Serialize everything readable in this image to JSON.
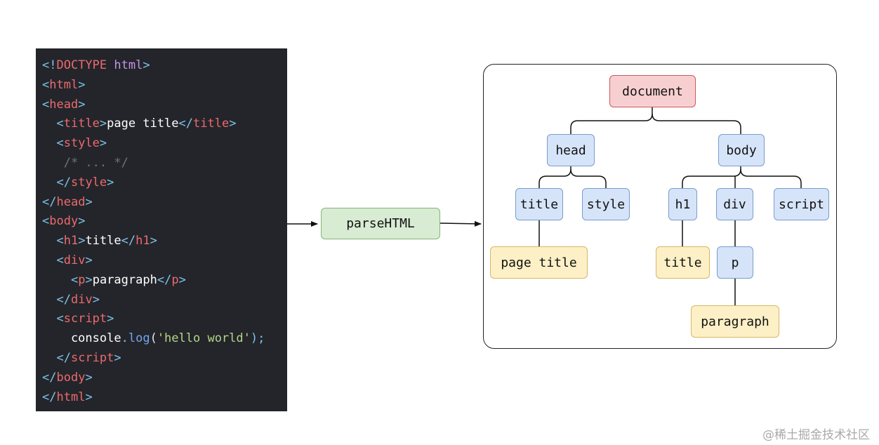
{
  "code": {
    "lines": [
      [
        {
          "t": "<!",
          "c": "punct"
        },
        {
          "t": "DOCTYPE",
          "c": "tag"
        },
        {
          "t": " html",
          "c": "attr"
        },
        {
          "t": ">",
          "c": "punct"
        }
      ],
      [
        {
          "t": "<",
          "c": "punct"
        },
        {
          "t": "html",
          "c": "tag"
        },
        {
          "t": ">",
          "c": "punct"
        }
      ],
      [
        {
          "t": "<",
          "c": "punct"
        },
        {
          "t": "head",
          "c": "tag"
        },
        {
          "t": ">",
          "c": "punct"
        }
      ],
      [
        {
          "t": "  ",
          "c": "plain"
        },
        {
          "t": "<",
          "c": "punct"
        },
        {
          "t": "title",
          "c": "tag"
        },
        {
          "t": ">",
          "c": "punct"
        },
        {
          "t": "page title",
          "c": "text"
        },
        {
          "t": "</",
          "c": "punct"
        },
        {
          "t": "title",
          "c": "tag"
        },
        {
          "t": ">",
          "c": "punct"
        }
      ],
      [
        {
          "t": "  ",
          "c": "plain"
        },
        {
          "t": "<",
          "c": "punct"
        },
        {
          "t": "style",
          "c": "tag"
        },
        {
          "t": ">",
          "c": "punct"
        }
      ],
      [
        {
          "t": "   /* ... */",
          "c": "comment"
        }
      ],
      [
        {
          "t": "  ",
          "c": "plain"
        },
        {
          "t": "</",
          "c": "punct"
        },
        {
          "t": "style",
          "c": "tag"
        },
        {
          "t": ">",
          "c": "punct"
        }
      ],
      [
        {
          "t": "</",
          "c": "punct"
        },
        {
          "t": "head",
          "c": "tag"
        },
        {
          "t": ">",
          "c": "punct"
        }
      ],
      [
        {
          "t": "<",
          "c": "punct"
        },
        {
          "t": "body",
          "c": "tag"
        },
        {
          "t": ">",
          "c": "punct"
        }
      ],
      [
        {
          "t": "  ",
          "c": "plain"
        },
        {
          "t": "<",
          "c": "punct"
        },
        {
          "t": "h1",
          "c": "tag"
        },
        {
          "t": ">",
          "c": "punct"
        },
        {
          "t": "title",
          "c": "text"
        },
        {
          "t": "</",
          "c": "punct"
        },
        {
          "t": "h1",
          "c": "tag"
        },
        {
          "t": ">",
          "c": "punct"
        }
      ],
      [
        {
          "t": "  ",
          "c": "plain"
        },
        {
          "t": "<",
          "c": "punct"
        },
        {
          "t": "div",
          "c": "tag"
        },
        {
          "t": ">",
          "c": "punct"
        }
      ],
      [
        {
          "t": "    ",
          "c": "plain"
        },
        {
          "t": "<",
          "c": "punct"
        },
        {
          "t": "p",
          "c": "tag"
        },
        {
          "t": ">",
          "c": "punct"
        },
        {
          "t": "paragraph",
          "c": "text"
        },
        {
          "t": "</",
          "c": "punct"
        },
        {
          "t": "p",
          "c": "tag"
        },
        {
          "t": ">",
          "c": "punct"
        }
      ],
      [
        {
          "t": "  ",
          "c": "plain"
        },
        {
          "t": "</",
          "c": "punct"
        },
        {
          "t": "div",
          "c": "tag"
        },
        {
          "t": ">",
          "c": "punct"
        }
      ],
      [
        {
          "t": "  ",
          "c": "plain"
        },
        {
          "t": "<",
          "c": "punct"
        },
        {
          "t": "script",
          "c": "tag"
        },
        {
          "t": ">",
          "c": "punct"
        }
      ],
      [
        {
          "t": "    console",
          "c": "text"
        },
        {
          "t": ".",
          "c": "punct"
        },
        {
          "t": "log",
          "c": "fn"
        },
        {
          "t": "(",
          "c": "plain"
        },
        {
          "t": "'hello world'",
          "c": "str"
        },
        {
          "t": ");",
          "c": "punct"
        }
      ],
      [
        {
          "t": "  ",
          "c": "plain"
        },
        {
          "t": "</",
          "c": "punct"
        },
        {
          "t": "script",
          "c": "tag"
        },
        {
          "t": ">",
          "c": "punct"
        }
      ],
      [
        {
          "t": "</",
          "c": "punct"
        },
        {
          "t": "body",
          "c": "tag"
        },
        {
          "t": ">",
          "c": "punct"
        }
      ],
      [
        {
          "t": "</",
          "c": "punct"
        },
        {
          "t": "html",
          "c": "tag"
        },
        {
          "t": ">",
          "c": "punct"
        }
      ]
    ]
  },
  "parser": {
    "label": "parseHTML"
  },
  "tree": {
    "document": "document",
    "head": "head",
    "body": "body",
    "title": "title",
    "style": "style",
    "h1": "h1",
    "div": "div",
    "script": "script",
    "page_title_text": "page title",
    "h1_title_text": "title",
    "p": "p",
    "paragraph_text": "paragraph"
  },
  "watermark": "@稀土掘金技术社区",
  "colors": {
    "code_bg": "#23252a",
    "document_fill": "#f8cfd1",
    "element_fill": "#d6e4f9",
    "text_fill": "#fdf0c6",
    "parser_fill": "#d8ebd3"
  }
}
